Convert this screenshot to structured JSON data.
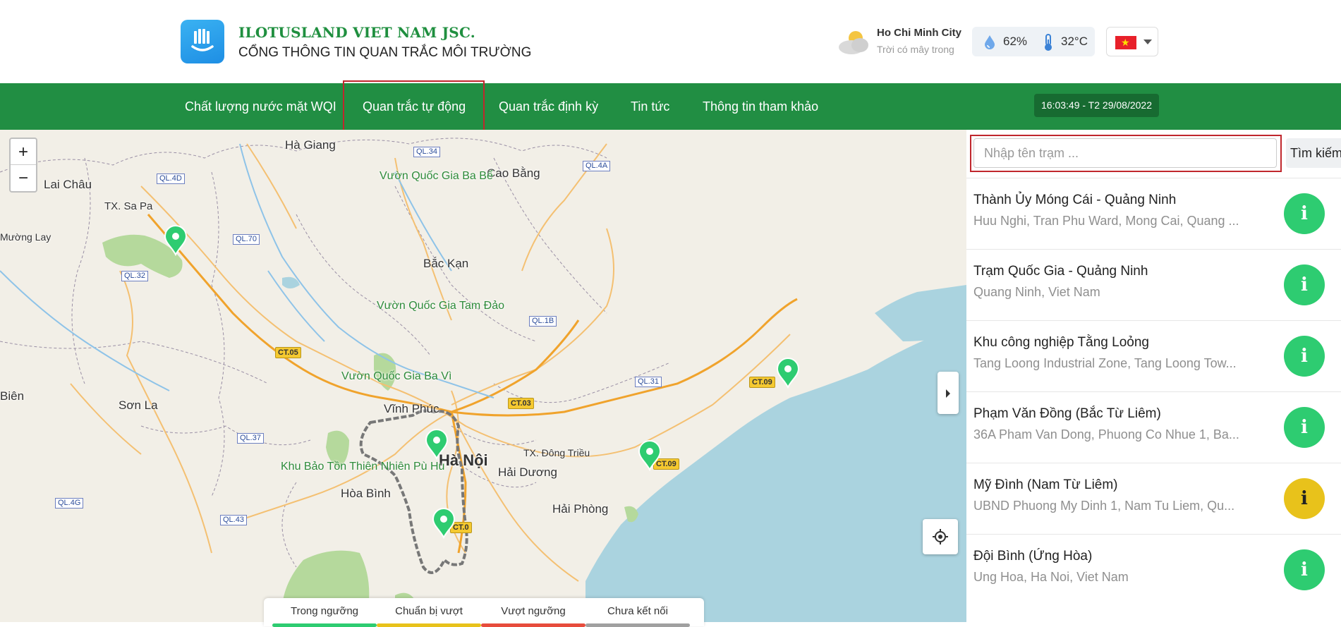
{
  "header": {
    "brand_name": "ILOTUSLAND VIET NAM JSC.",
    "brand_sub": "CỔNG THÔNG TIN QUAN TRẮC MÔI TRƯỜNG",
    "weather": {
      "city": "Ho Chi Minh City",
      "description": "Trời có mây trong",
      "humidity": "62%",
      "temperature": "32°C",
      "icon": "partly-cloudy-icon"
    },
    "language": "vietnam-flag"
  },
  "nav": {
    "items": [
      {
        "label": "Chất lượng nước mặt WQI"
      },
      {
        "label": "Quan trắc tự động"
      },
      {
        "label": "Quan trắc định kỳ"
      },
      {
        "label": "Tin tức"
      },
      {
        "label": "Thông tin tham khảo"
      }
    ],
    "active_index": 1,
    "clock": "16:03:49 - T2 29/08/2022"
  },
  "map": {
    "places": [
      "Hà Giang",
      "Cao Bằng",
      "Lai Châu",
      "TX. Sa Pa",
      "Mường Lay",
      "Bắc Kạn",
      "Vĩnh Phúc",
      "Sơn La",
      "Hòa Bình",
      "Hải Dương",
      "Hải Phòng",
      "TX. Đông Triều",
      "Biên",
      "Hà Nội"
    ],
    "parks": [
      "Vườn Quốc Gia Ba Bể",
      "Vườn Quốc Gia Tam Đảo",
      "Vườn Quốc Gia Ba Vì",
      "Khu Bảo Tồn Thiên Nhiên Pù Hu"
    ],
    "roads": [
      "QL.34",
      "QL.4D",
      "QL.4A",
      "QL.70",
      "QL.32",
      "QL.1B",
      "QL.31",
      "QL.37",
      "QL.4G",
      "QL.43"
    ],
    "expressways": [
      "CT.05",
      "CT.03",
      "CT.09",
      "CT.09",
      "CT.0"
    ],
    "zoom_in": "+",
    "zoom_out": "−"
  },
  "legend": [
    {
      "label": "Trong ngưỡng",
      "color": "#2ecc71"
    },
    {
      "label": "Chuẩn bị vượt",
      "color": "#e8c21b"
    },
    {
      "label": "Vượt ngưỡng",
      "color": "#e74c3c"
    },
    {
      "label": "Chưa kết nối",
      "color": "#a0a0a0"
    }
  ],
  "search": {
    "placeholder": "Nhập tên trạm ...",
    "button": "Tìm kiếm"
  },
  "stations": [
    {
      "name": "Thành Ủy Móng Cái - Quảng Ninh",
      "address": "Huu Nghi, Tran Phu Ward, Mong Cai, Quang ...",
      "status_color": "#2ecc71"
    },
    {
      "name": "Trạm Quốc Gia - Quảng Ninh",
      "address": "Quang Ninh, Viet Nam",
      "status_color": "#2ecc71"
    },
    {
      "name": "Khu công nghiệp Tằng Loỏng",
      "address": "Tang Loong Industrial Zone, Tang Loong Tow...",
      "status_color": "#2ecc71"
    },
    {
      "name": "Phạm Văn Đồng (Bắc Từ Liêm)",
      "address": "36A Pham Van Dong, Phuong Co Nhue 1, Ba...",
      "status_color": "#2ecc71"
    },
    {
      "name": "Mỹ Đình (Nam Từ Liêm)",
      "address": "UBND Phuong My Dinh 1, Nam Tu Liem, Qu...",
      "status_color": "#e8c21b"
    },
    {
      "name": "Đội Bình (Ứng Hòa)",
      "address": "Ung Hoa, Ha Noi, Viet Nam",
      "status_color": "#2ecc71"
    }
  ],
  "info_glyph": "i"
}
